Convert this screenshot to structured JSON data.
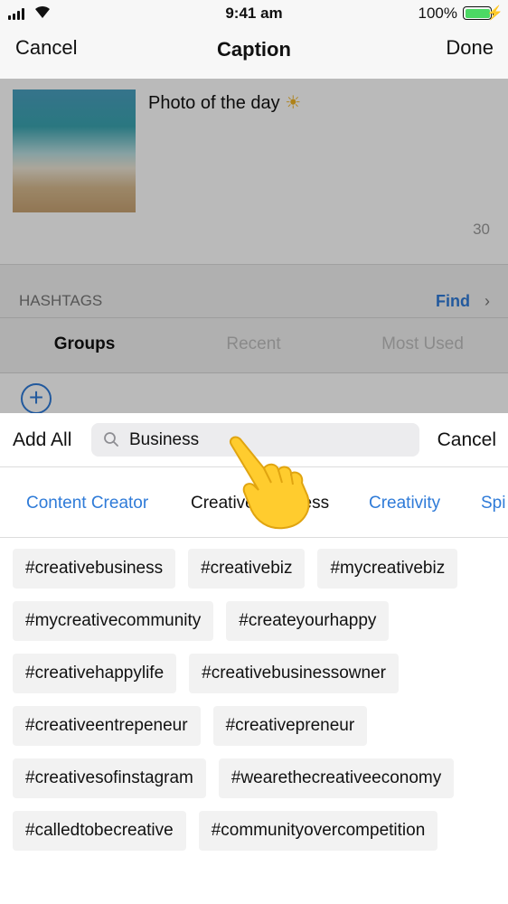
{
  "status_bar": {
    "time": "9:41 am",
    "battery_percent": "100%",
    "battery_level": 1.0
  },
  "nav": {
    "cancel": "Cancel",
    "title": "Caption",
    "done": "Done"
  },
  "caption": {
    "text": "Photo of the day",
    "emoji": "☀",
    "char_count": "30"
  },
  "hashtags": {
    "header": "HASHTAGS",
    "find": "Find",
    "tabs": [
      {
        "label": "Groups",
        "active": true
      },
      {
        "label": "Recent",
        "active": false
      },
      {
        "label": "Most Used",
        "active": false
      }
    ],
    "add_icon": "plus-circle-icon"
  },
  "sheet": {
    "add_all": "Add All",
    "search": {
      "value": "Business",
      "placeholder": "Search"
    },
    "cancel": "Cancel",
    "categories": [
      {
        "label": "Content Creator",
        "active": false
      },
      {
        "label": "Creative Business",
        "active": true
      },
      {
        "label": "Creativity",
        "active": false
      },
      {
        "label": "Spi",
        "active": false
      }
    ],
    "tag_rows": [
      [
        "#creativebusiness",
        "#creativebiz",
        "#mycreativebiz"
      ],
      [
        "#mycreativecommunity",
        "#createyourhappy"
      ],
      [
        "#creativehappylife",
        "#creativebusinessowner"
      ],
      [
        "#creativeentrepeneur",
        "#creativepreneur"
      ],
      [
        "#creativesofinstagram",
        "#wearethecreativeeconomy"
      ],
      [
        "#calledtobecreative",
        "#communityovercompetition"
      ]
    ]
  },
  "colors": {
    "accent": "#2f7bd8",
    "tag_background": "#f2f2f2",
    "battery": "#4cd964"
  }
}
